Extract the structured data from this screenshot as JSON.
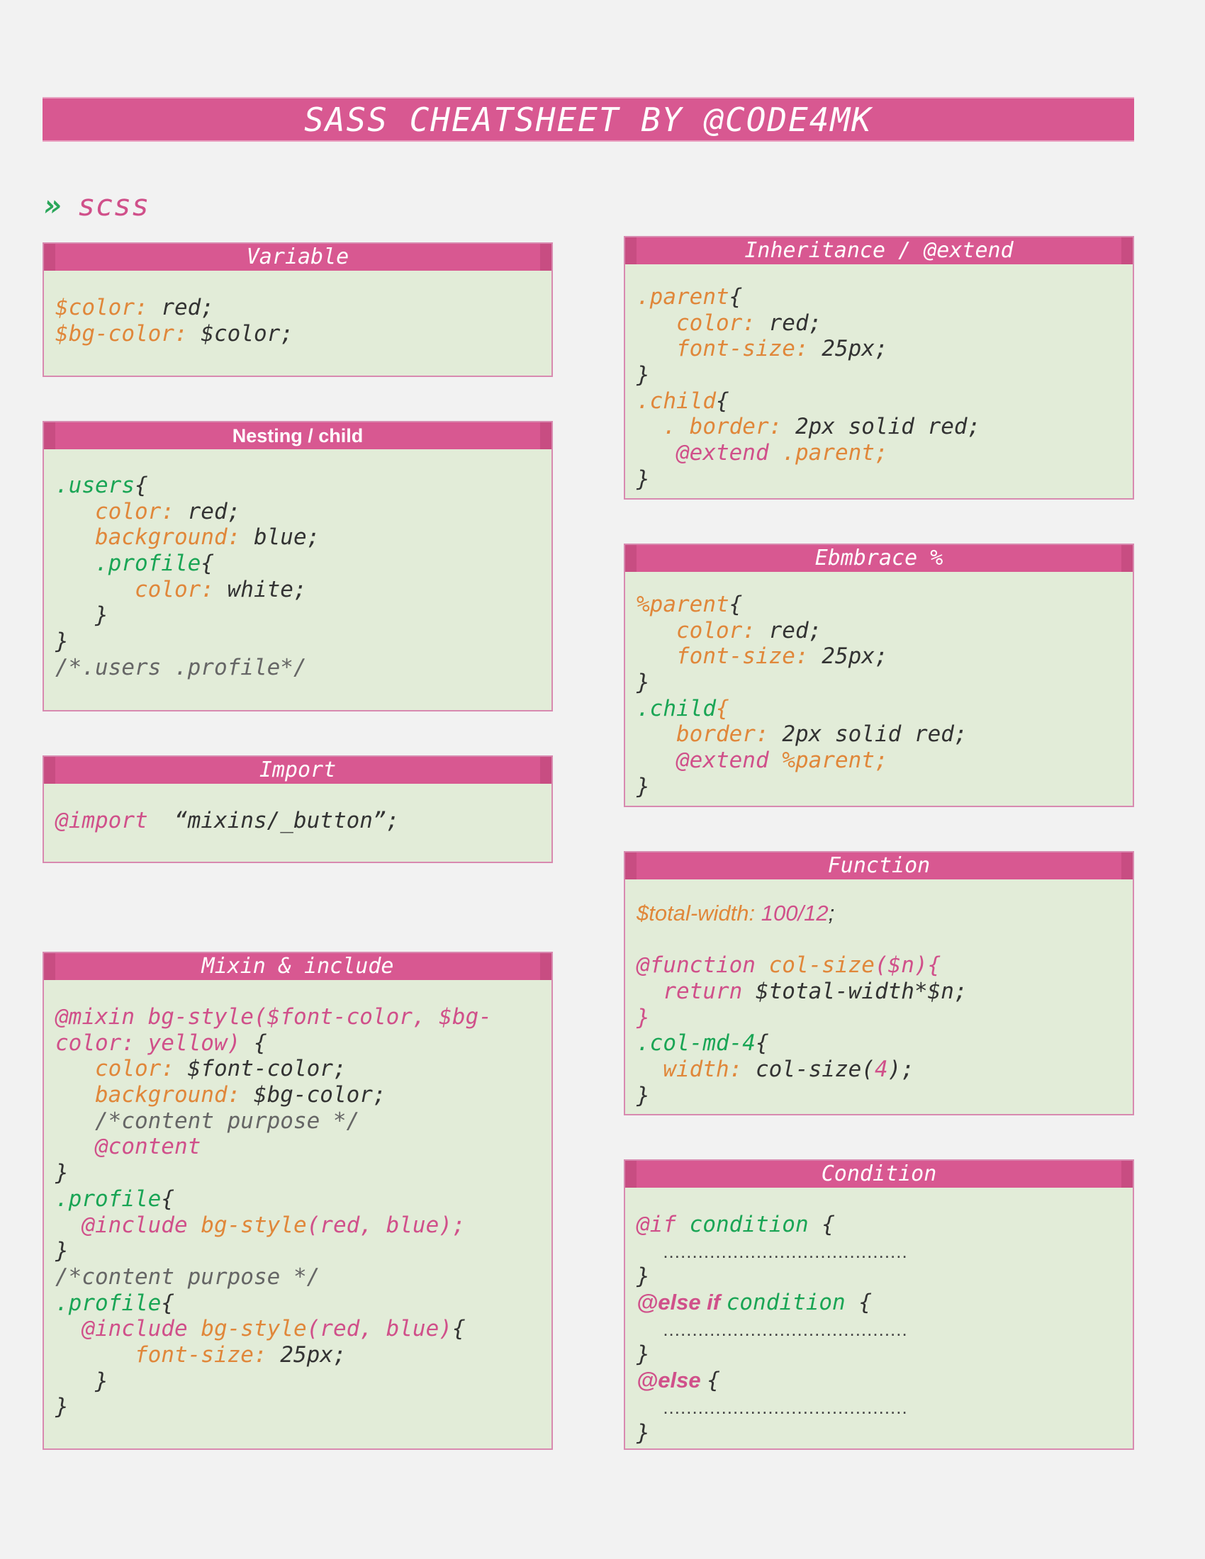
{
  "title": "SASS CHEATSHEET BY @CODE4MK",
  "section": {
    "arrow": "»",
    "label": "scss"
  },
  "cards": {
    "variable": {
      "title": "Variable",
      "lines": [
        [
          {
            "t": "$color: ",
            "c": "o"
          },
          {
            "t": "red;",
            "c": "d"
          }
        ],
        [
          {
            "t": "$bg-color: ",
            "c": "o"
          },
          {
            "t": "$color;",
            "c": "d"
          }
        ]
      ]
    },
    "nesting": {
      "title": "Nesting  / child",
      "lines": [
        [
          {
            "t": ".users",
            "c": "g"
          },
          {
            "t": "{",
            "c": "d"
          }
        ],
        [
          {
            "t": "   color: ",
            "c": "o"
          },
          {
            "t": "red;",
            "c": "d"
          }
        ],
        [
          {
            "t": "   background: ",
            "c": "o"
          },
          {
            "t": "blue;",
            "c": "d"
          }
        ],
        [
          {
            "t": "   .profile",
            "c": "g"
          },
          {
            "t": "{",
            "c": "d"
          }
        ],
        [
          {
            "t": "      color: ",
            "c": "o"
          },
          {
            "t": "white;",
            "c": "d"
          }
        ],
        [
          {
            "t": "   }",
            "c": "d"
          }
        ],
        [
          {
            "t": "}",
            "c": "d"
          }
        ],
        [
          {
            "t": "/*.users .profile*/",
            "c": "c"
          }
        ]
      ]
    },
    "import": {
      "title": "Import",
      "lines": [
        [
          {
            "t": "@import  ",
            "c": "p"
          },
          {
            "t": "“mixins/_button”;",
            "c": "d"
          }
        ]
      ]
    },
    "mixin": {
      "title": "Mixin & include",
      "lines": [
        [
          {
            "t": "@mixin bg-style($font-color, $bg-",
            "c": "p"
          }
        ],
        [
          {
            "t": "color: yellow) ",
            "c": "p"
          },
          {
            "t": "{",
            "c": "d"
          }
        ],
        [
          {
            "t": "   color: ",
            "c": "o"
          },
          {
            "t": "$font-color;",
            "c": "d"
          }
        ],
        [
          {
            "t": "   background: ",
            "c": "o"
          },
          {
            "t": "$bg-color;",
            "c": "d"
          }
        ],
        [
          {
            "t": "   /*content purpose */",
            "c": "c"
          }
        ],
        [
          {
            "t": "   @content",
            "c": "p"
          }
        ],
        [
          {
            "t": "}",
            "c": "d"
          }
        ],
        [
          {
            "t": ".profile",
            "c": "g"
          },
          {
            "t": "{",
            "c": "d"
          }
        ],
        [
          {
            "t": "  @include ",
            "c": "p"
          },
          {
            "t": "bg-style",
            "c": "o"
          },
          {
            "t": "(red, blue);",
            "c": "p"
          }
        ],
        [
          {
            "t": "}",
            "c": "d"
          }
        ],
        [
          {
            "t": "/*content purpose */",
            "c": "c"
          }
        ],
        [
          {
            "t": ".profile",
            "c": "g"
          },
          {
            "t": "{",
            "c": "d"
          }
        ],
        [
          {
            "t": "  @include ",
            "c": "p"
          },
          {
            "t": "bg-style",
            "c": "o"
          },
          {
            "t": "(red, blue)",
            "c": "p"
          },
          {
            "t": "{",
            "c": "d"
          }
        ],
        [
          {
            "t": "      font-size: ",
            "c": "o"
          },
          {
            "t": "25px;",
            "c": "d"
          }
        ],
        [
          {
            "t": "   }",
            "c": "d"
          }
        ],
        [
          {
            "t": "}",
            "c": "d"
          }
        ]
      ]
    },
    "inheritance": {
      "title": "Inheritance / @extend",
      "lines": [
        [
          {
            "t": ".parent",
            "c": "o"
          },
          {
            "t": "{",
            "c": "d"
          }
        ],
        [
          {
            "t": "   color: ",
            "c": "o"
          },
          {
            "t": "red;",
            "c": "d"
          }
        ],
        [
          {
            "t": "   font-size: ",
            "c": "o"
          },
          {
            "t": "25px;",
            "c": "d"
          }
        ],
        [
          {
            "t": "}",
            "c": "d"
          }
        ],
        [
          {
            "t": ".child",
            "c": "o"
          },
          {
            "t": "{",
            "c": "d"
          }
        ],
        [
          {
            "t": "  . border: ",
            "c": "o"
          },
          {
            "t": "2px solid red;",
            "c": "d"
          }
        ],
        [
          {
            "t": "   @extend ",
            "c": "p"
          },
          {
            "t": ".parent;",
            "c": "o"
          }
        ],
        [
          {
            "t": "}",
            "c": "d"
          }
        ]
      ]
    },
    "embrace": {
      "title": "Ebmbrace %",
      "lines": [
        [
          {
            "t": "%parent",
            "c": "o"
          },
          {
            "t": "{",
            "c": "d"
          }
        ],
        [
          {
            "t": "   color: ",
            "c": "o"
          },
          {
            "t": "red;",
            "c": "d"
          }
        ],
        [
          {
            "t": "   font-size: ",
            "c": "o"
          },
          {
            "t": "25px;",
            "c": "d"
          }
        ],
        [
          {
            "t": "}",
            "c": "d"
          }
        ],
        [
          {
            "t": ".child",
            "c": "g"
          },
          {
            "t": "{",
            "c": "o"
          }
        ],
        [
          {
            "t": "   border: ",
            "c": "o"
          },
          {
            "t": "2px solid red;",
            "c": "d"
          }
        ],
        [
          {
            "t": "   @extend ",
            "c": "p"
          },
          {
            "t": "%parent;",
            "c": "o"
          }
        ],
        [
          {
            "t": "}",
            "c": "d"
          }
        ]
      ]
    },
    "function": {
      "title": "Function",
      "lines": [
        [
          {
            "t": "$total-width: ",
            "c": "o sans"
          },
          {
            "t": "100/12",
            "c": "p sans"
          },
          {
            "t": ";",
            "c": "d sans"
          }
        ],
        [
          {
            "t": " ",
            "c": "d"
          }
        ],
        [
          {
            "t": "@function ",
            "c": "p"
          },
          {
            "t": "col-size",
            "c": "o"
          },
          {
            "t": "($n){",
            "c": "p"
          }
        ],
        [
          {
            "t": "  return ",
            "c": "p"
          },
          {
            "t": "$total-width*$n;",
            "c": "d"
          }
        ],
        [
          {
            "t": "}",
            "c": "p"
          }
        ],
        [
          {
            "t": ".col-md-4",
            "c": "g"
          },
          {
            "t": "{",
            "c": "d"
          }
        ],
        [
          {
            "t": "  width: ",
            "c": "o"
          },
          {
            "t": "col-size(",
            "c": "d"
          },
          {
            "t": "4",
            "c": "p"
          },
          {
            "t": ");",
            "c": "d"
          }
        ],
        [
          {
            "t": "}",
            "c": "d"
          }
        ]
      ]
    },
    "condition": {
      "title": "Condition",
      "lines": [
        [
          {
            "t": "@if ",
            "c": "p"
          },
          {
            "t": "condition ",
            "c": "g"
          },
          {
            "t": "{",
            "c": "d"
          }
        ],
        [
          {
            "t": "  ",
            "c": "d"
          },
          {
            "t": "..........................................",
            "c": "dots"
          }
        ],
        [
          {
            "t": "}",
            "c": "d"
          }
        ],
        [
          {
            "t": "@else if ",
            "c": "p sb"
          },
          {
            "t": "condition ",
            "c": "g"
          },
          {
            "t": "{",
            "c": "d"
          }
        ],
        [
          {
            "t": "  ",
            "c": "d"
          },
          {
            "t": "..........................................",
            "c": "dots"
          }
        ],
        [
          {
            "t": "}",
            "c": "d"
          }
        ],
        [
          {
            "t": "@else ",
            "c": "p sb"
          },
          {
            "t": "{",
            "c": "d"
          }
        ],
        [
          {
            "t": "  ",
            "c": "d"
          },
          {
            "t": "..........................................",
            "c": "dots"
          }
        ],
        [
          {
            "t": "}",
            "c": "d"
          }
        ]
      ]
    }
  }
}
